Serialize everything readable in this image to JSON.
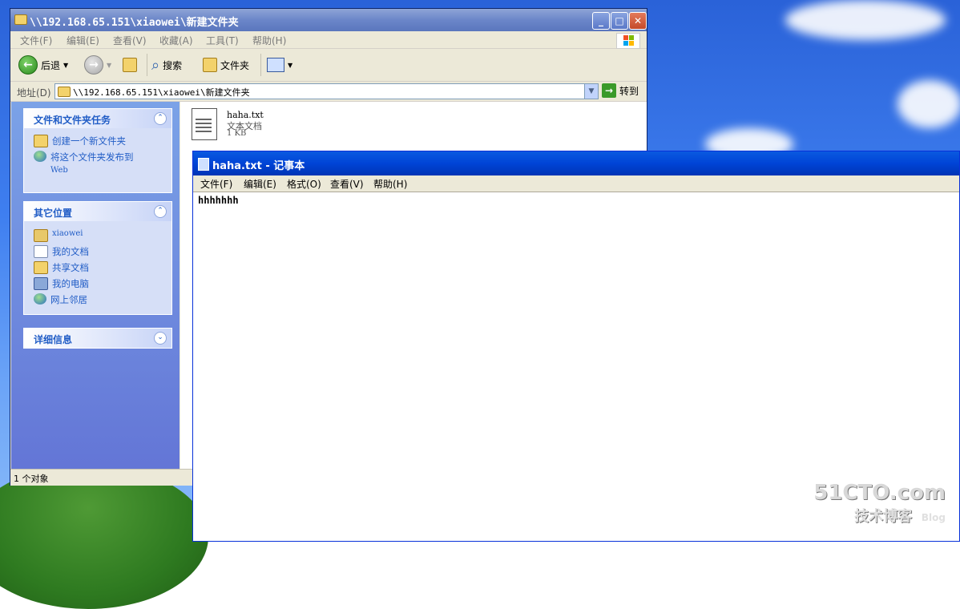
{
  "explorer": {
    "title": "\\\\192.168.65.151\\xiaowei\\新建文件夹",
    "menu": [
      "文件(F)",
      "编辑(E)",
      "查看(V)",
      "收藏(A)",
      "工具(T)",
      "帮助(H)"
    ],
    "toolbar": {
      "back": "后退",
      "search": "搜索",
      "folders": "文件夹"
    },
    "address": {
      "label": "地址(D)",
      "value": "\\\\192.168.65.151\\xiaowei\\新建文件夹",
      "go": "转到"
    },
    "tasks": {
      "header": "文件和文件夹任务",
      "items": [
        "创建一个新文件夹",
        "将这个文件夹发布到",
        "Web"
      ]
    },
    "other_places": {
      "header": "其它位置",
      "items": [
        "xiaowei",
        "我的文档",
        "共享文档",
        "我的电脑",
        "网上邻居"
      ]
    },
    "details": {
      "header": "详细信息"
    },
    "file": {
      "name": "haha.txt",
      "type": "文本文档",
      "size": "1 KB"
    },
    "status": "1 个对象"
  },
  "notepad": {
    "title": "haha.txt - 记事本",
    "menu": [
      "文件(F)",
      "编辑(E)",
      "格式(O)",
      "查看(V)",
      "帮助(H)"
    ],
    "content": "hhhhhhh"
  },
  "watermark": {
    "line1": "51CTO.com",
    "line2": "技术博客",
    "line3": "Blog"
  },
  "colors": {
    "xp_blue": "#0054e3",
    "task_blue": "#215dc6"
  }
}
